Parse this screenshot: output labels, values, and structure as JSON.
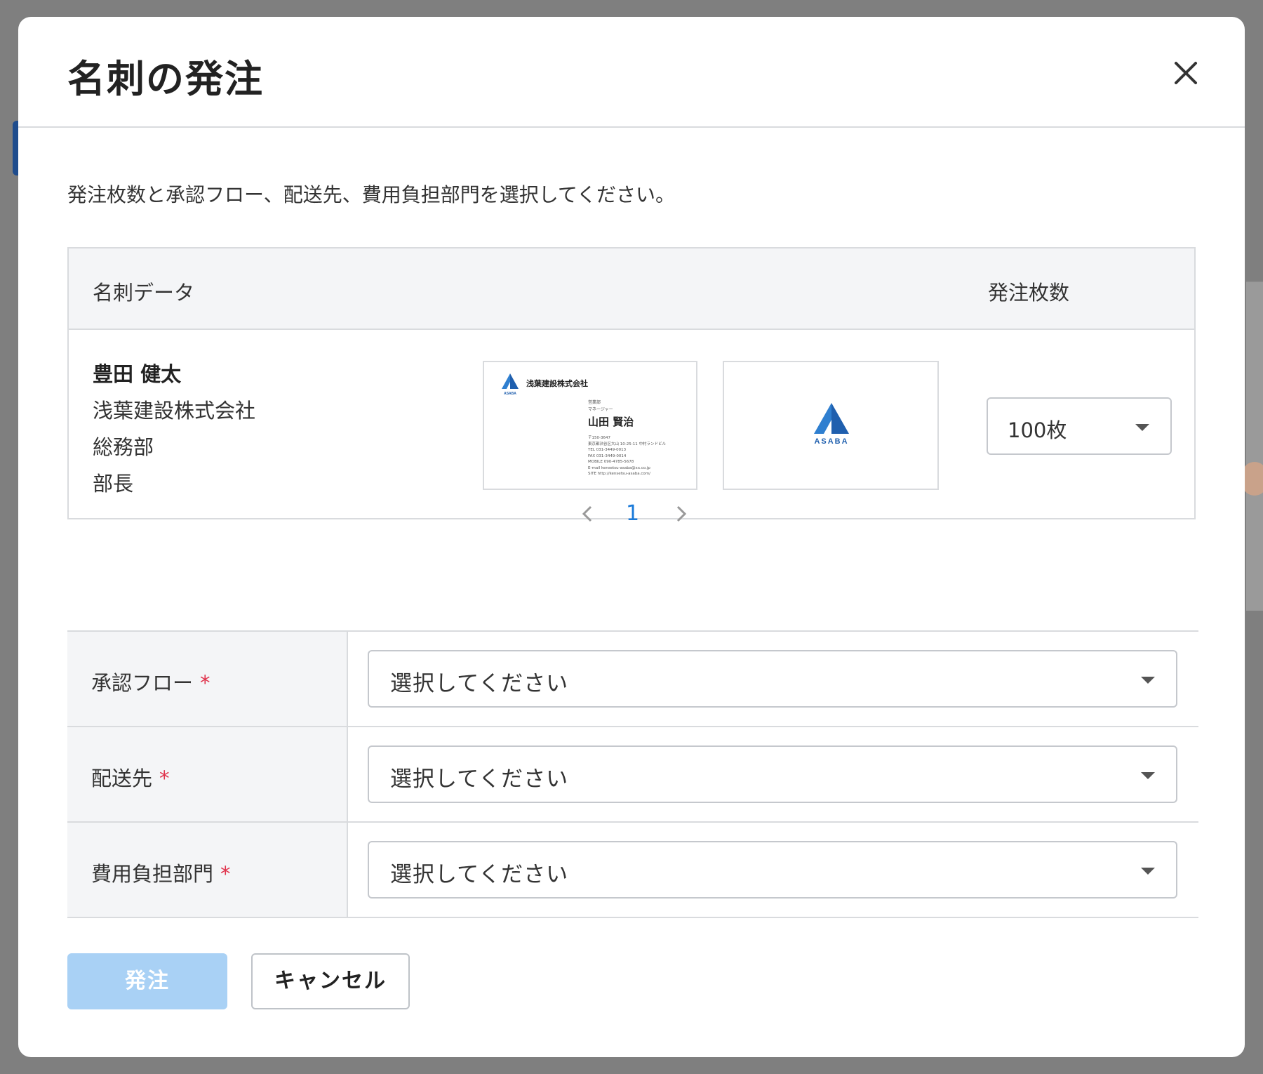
{
  "modal": {
    "title": "名刺の発注",
    "intro": "発注枚数と承認フロー、配送先、費用負担部門を選択してください。"
  },
  "card_table": {
    "header_data": "名刺データ",
    "header_qty": "発注枚数",
    "row": {
      "name": "豊田 健太",
      "company": "浅葉建設株式会社",
      "department": "総務部",
      "position": "部長",
      "card_front": {
        "company": "浅葉建設株式会社",
        "department": "営業部",
        "title": "マネージャー",
        "name": "山田 賢治",
        "info": "〒150-3647\n東京都渋谷区大山 10-25-11 中村ランドビル\nTEL 031-3449-0013\nFAX 031-3449-0014\nMOBILE 090-4785-5678\nE-mail kensetsu-asaba@xx.co.jp\nSITE http://kensetsu-asaba.com/"
      },
      "logo_text": "ASABA",
      "quantity": "100枚"
    }
  },
  "pagination": {
    "current_page": "1"
  },
  "form": {
    "rows": [
      {
        "label": "承認フロー",
        "required_mark": "*",
        "value": "選択してください"
      },
      {
        "label": "配送先",
        "required_mark": "*",
        "value": "選択してください"
      },
      {
        "label": "費用負担部門",
        "required_mark": "*",
        "value": "選択してください"
      }
    ]
  },
  "buttons": {
    "order": "発注",
    "cancel": "キャンセル"
  },
  "colors": {
    "primary_disabled": "#a9d1f5",
    "link": "#1a7ad9",
    "required": "#e0334c",
    "logo_blue": "#1f5fae"
  }
}
